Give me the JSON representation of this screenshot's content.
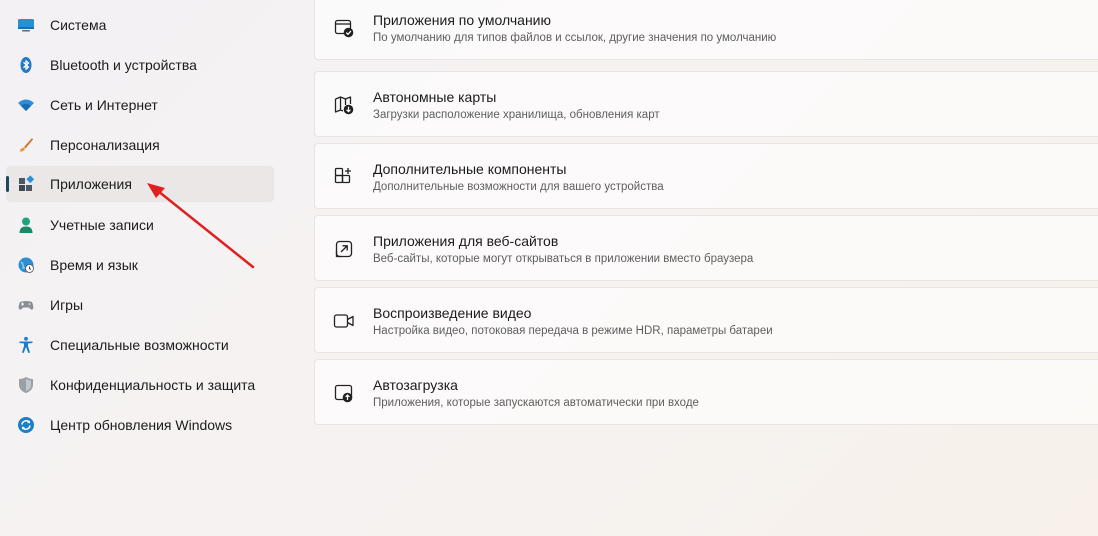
{
  "sidebar": {
    "items": [
      {
        "label": "Система",
        "icon": "display-icon"
      },
      {
        "label": "Bluetooth и устройства",
        "icon": "bluetooth-icon"
      },
      {
        "label": "Сеть и Интернет",
        "icon": "wifi-icon"
      },
      {
        "label": "Персонализация",
        "icon": "brush-icon"
      },
      {
        "label": "Приложения",
        "icon": "apps-icon",
        "selected": true
      },
      {
        "label": "Учетные записи",
        "icon": "person-icon"
      },
      {
        "label": "Время и язык",
        "icon": "globe-clock-icon"
      },
      {
        "label": "Игры",
        "icon": "gamepad-icon"
      },
      {
        "label": "Специальные возможности",
        "icon": "accessibility-icon"
      },
      {
        "label": "Конфиденциальность и защита",
        "icon": "shield-icon"
      },
      {
        "label": "Центр обновления Windows",
        "icon": "update-icon"
      }
    ]
  },
  "settings": {
    "cards": [
      {
        "title": "Приложения по умолчанию",
        "description": "По умолчанию для типов файлов и ссылок, другие значения по умолчанию",
        "icon": "default-apps-icon"
      },
      {
        "title": "Автономные карты",
        "description": "Загрузки расположение хранилища, обновления карт",
        "icon": "map-download-icon"
      },
      {
        "title": "Дополнительные компоненты",
        "description": "Дополнительные возможности для вашего устройства",
        "icon": "add-components-icon"
      },
      {
        "title": "Приложения для веб-сайтов",
        "description": "Веб-сайты, которые могут открываться в приложении вместо браузера",
        "icon": "open-external-icon"
      },
      {
        "title": "Воспроизведение видео",
        "description": "Настройка видео, потоковая передача в режиме HDR, параметры батареи",
        "icon": "video-camera-icon"
      },
      {
        "title": "Автозагрузка",
        "description": "Приложения, которые запускаются автоматически при входе",
        "icon": "startup-icon"
      }
    ]
  },
  "colors": {
    "accent": "#1a4a5c",
    "annotation_arrow": "#e02020"
  }
}
